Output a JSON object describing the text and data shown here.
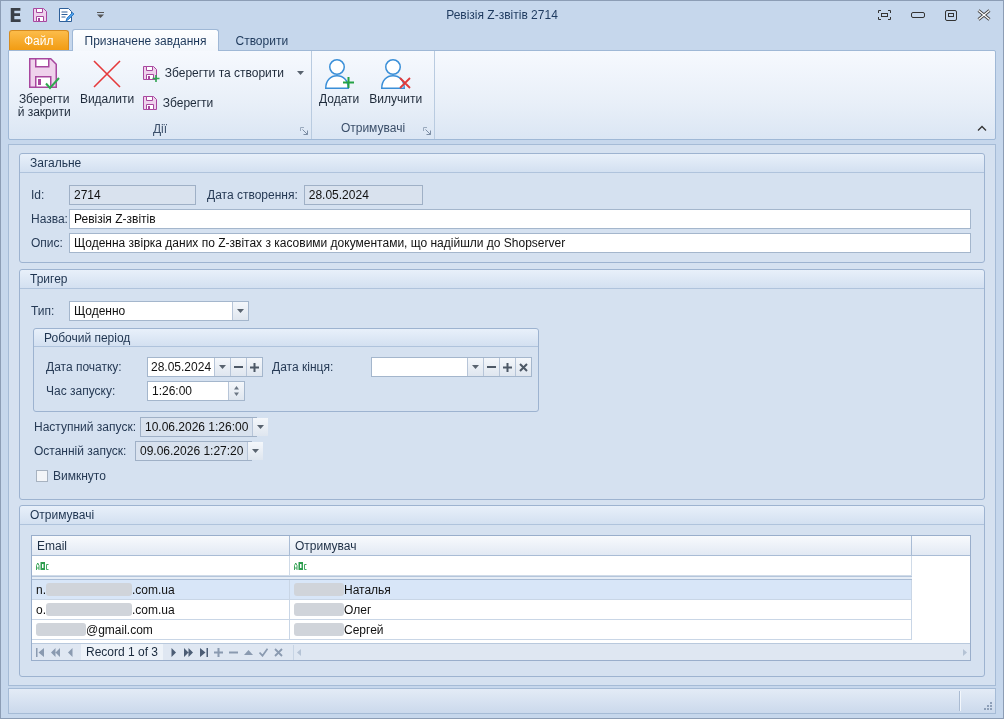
{
  "window": {
    "logo": "E",
    "title": "Ревізія Z-звітів 2714"
  },
  "ribbon": {
    "tabs": [
      {
        "label": "Файл",
        "kind": "file",
        "selected": false
      },
      {
        "label": "Призначене завдання",
        "kind": "page",
        "selected": true
      },
      {
        "label": "Створити",
        "kind": "page",
        "selected": false
      }
    ],
    "groups": [
      {
        "label": "Дії",
        "buttons": [
          {
            "kind": "large",
            "label": "Зберегти й закрити"
          },
          {
            "kind": "large",
            "label": "Видалити"
          },
          {
            "kind": "split",
            "label": "Зберегти та створити"
          },
          {
            "kind": "small",
            "label": "Зберегти"
          }
        ]
      },
      {
        "label": "Отримувачі",
        "buttons": [
          {
            "kind": "large",
            "label": "Додати"
          },
          {
            "kind": "large",
            "label": "Вилучити"
          }
        ]
      }
    ]
  },
  "general": {
    "title": "Загальне",
    "rows": [
      {
        "fields": [
          {
            "label": "Id:",
            "value": "2714",
            "readonly": true
          },
          {
            "label": "Дата створення:",
            "value": "28.05.2024",
            "readonly": true
          }
        ]
      },
      {
        "fields": [
          {
            "label": "Назва:",
            "value": "Ревізія Z-звітів",
            "readonly": false
          }
        ]
      },
      {
        "fields": [
          {
            "label": "Опис:",
            "value": "Щоденна звірка даних по Z-звітах з касовими документами, що надійшли до Shopserver",
            "readonly": false
          }
        ]
      }
    ]
  },
  "trigger": {
    "title": "Тригер",
    "type": {
      "label": "Тип:",
      "value": "Щоденно"
    },
    "work_period": {
      "title": "Робочий період",
      "start_date": {
        "label": "Дата початку:",
        "value": "28.05.2024",
        "clearable": false
      },
      "end_date": {
        "label": "Дата кінця:",
        "clearable": true
      },
      "start_time": {
        "label": "Час запуску:",
        "value": "1:26:00"
      }
    },
    "next_run": {
      "label": "Наступний запуск:",
      "value": "10.06.2026 1:26:00",
      "readonly": true
    },
    "last_run": {
      "label": "Останній запуск:",
      "value": "09.06.2026 1:27:20",
      "readonly": true
    },
    "disabled": {
      "label": "Вимкнуто",
      "checked": false
    }
  },
  "recipients": {
    "title": "Отримувачі",
    "table": {
      "columns": [
        "Email",
        "Отримувач"
      ],
      "rows": [
        {
          "selected": true,
          "cells": [
            [
              {
                "kind": "text",
                "text": "n."
              },
              {
                "kind": "redacted"
              },
              {
                "kind": "text",
                "text": ".com.ua"
              }
            ],
            [
              {
                "kind": "redacted"
              },
              {
                "kind": "text",
                "text": "Наталья"
              }
            ]
          ]
        },
        {
          "selected": false,
          "cells": [
            [
              {
                "kind": "text",
                "text": "o."
              },
              {
                "kind": "redacted"
              },
              {
                "kind": "text",
                "text": ".com.ua"
              }
            ],
            [
              {
                "kind": "redacted"
              },
              {
                "kind": "text",
                "text": "Олег"
              }
            ]
          ]
        },
        {
          "selected": false,
          "cells": [
            [
              {
                "kind": "redacted"
              },
              {
                "kind": "text",
                "text": "@gmail.com"
              }
            ],
            [
              {
                "kind": "redacted"
              },
              {
                "kind": "text",
                "text": "Сергей"
              }
            ]
          ]
        }
      ]
    },
    "navigator": {
      "record": "Record 1 of 3"
    }
  }
}
